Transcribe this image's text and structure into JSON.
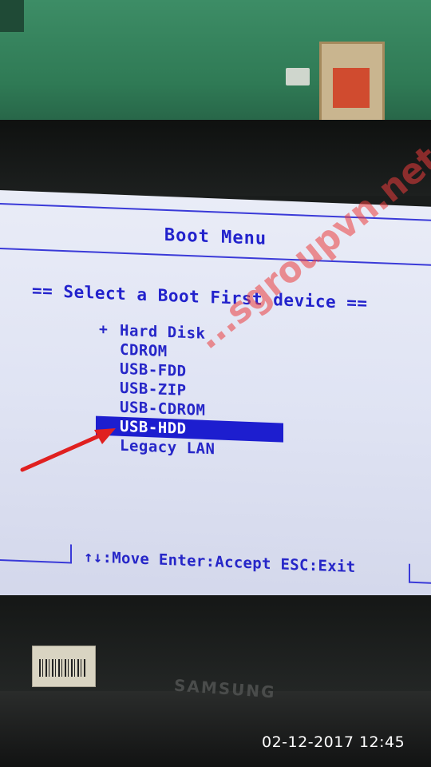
{
  "boot_menu": {
    "title": "Boot Menu",
    "subtitle": "== Select a Boot First device ==",
    "devices": [
      {
        "marker": "+",
        "label": "Hard Disk"
      },
      {
        "marker": "",
        "label": "CDROM"
      },
      {
        "marker": "",
        "label": "USB-FDD"
      },
      {
        "marker": "",
        "label": "USB-ZIP"
      },
      {
        "marker": "",
        "label": "USB-CDROM"
      },
      {
        "marker": "",
        "label": "USB-HDD"
      },
      {
        "marker": "",
        "label": "Legacy LAN"
      }
    ],
    "selected_device": "USB-HDD",
    "help": "↑↓:Move Enter:Accept ESC:Exit"
  },
  "watermark": "...sgroupvn.net",
  "monitor_brand": "SAMSUNG",
  "timestamp": "02-12-2017 12:45",
  "colors": {
    "text": "#2626c8",
    "highlight": "#1d1ecf",
    "screen_bg": "#e6e9f5",
    "annotation_arrow": "#e02020"
  }
}
